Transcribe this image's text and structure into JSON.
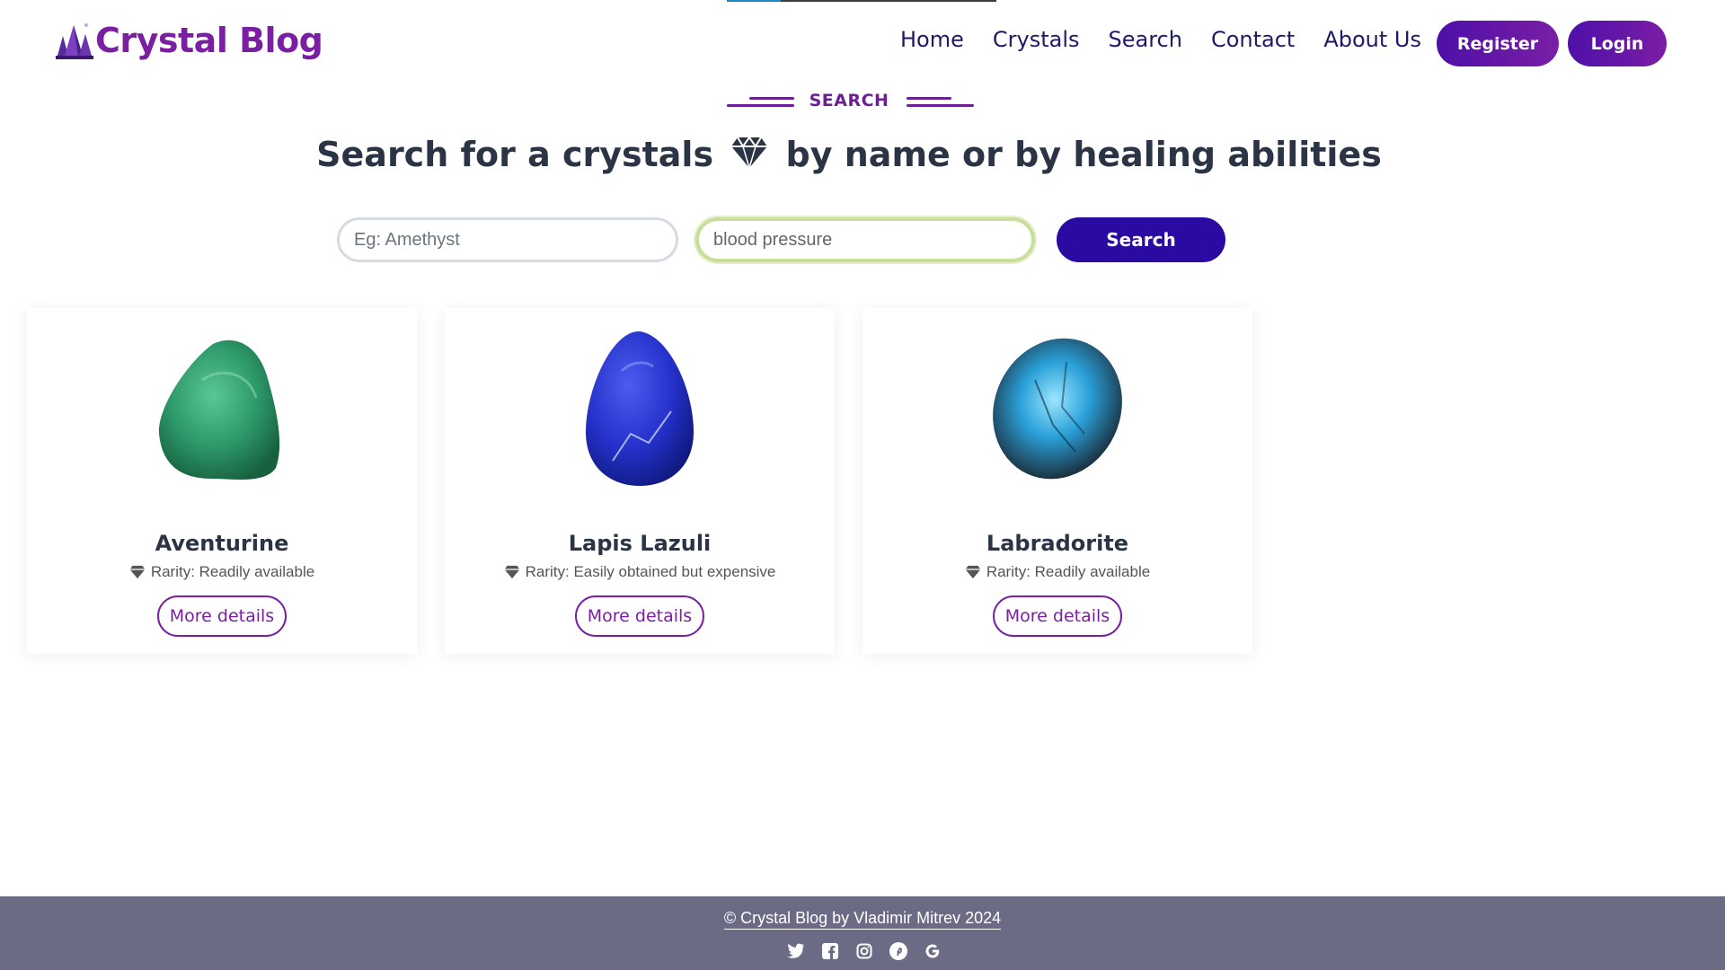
{
  "header": {
    "logo_text": "Crystal Blog",
    "nav": [
      "Home",
      "Crystals",
      "Search",
      "Contact",
      "About Us"
    ],
    "register_label": "Register",
    "login_label": "Login"
  },
  "section": {
    "label": "SEARCH",
    "headline_part1": "Search for a crystals",
    "headline_part2": "by name or by healing abilities"
  },
  "search": {
    "name_placeholder": "Eg: Amethyst",
    "name_value": "",
    "ability_value": "blood pressure",
    "button_label": "Search"
  },
  "results": [
    {
      "name": "Aventurine",
      "rarity": "Rarity: Readily available",
      "button": "More details",
      "stone_color": "#2e9a6a"
    },
    {
      "name": "Lapis Lazuli",
      "rarity": "Rarity: Easily obtained but expensive",
      "button": "More details",
      "stone_color": "#2430c8"
    },
    {
      "name": "Labradorite",
      "rarity": "Rarity: Readily available",
      "button": "More details",
      "stone_color": "#2aa0d8"
    }
  ],
  "footer": {
    "copyright": "© Crystal Blog by Vladimir Mitrev 2024",
    "social_icons": [
      "twitter-icon",
      "facebook-icon",
      "instagram-icon",
      "pinterest-icon",
      "google-icon"
    ]
  },
  "colors": {
    "brand_purple": "#7a1fa2",
    "nav_text": "#1e1a66",
    "search_button": "#2a0aa0",
    "footer_bg": "#6b6b86"
  }
}
